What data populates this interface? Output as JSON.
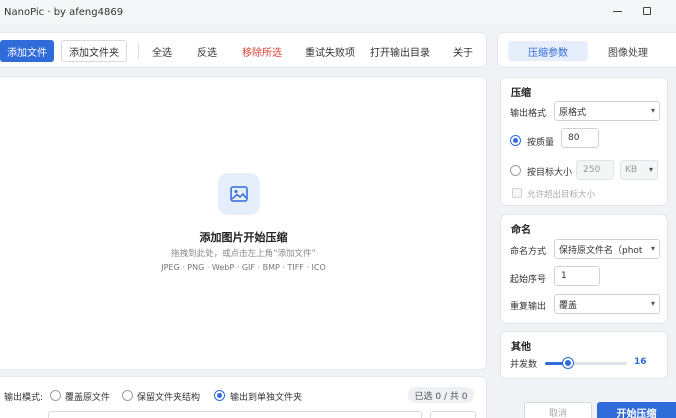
{
  "window": {
    "title": "NanoPic · by afeng4869"
  },
  "toolbar": {
    "add_file": "添加文件",
    "add_folder": "添加文件夹",
    "select_all": "全选",
    "invert": "反选",
    "remove_selected": "移除所选",
    "retry_failed": "重试失败项",
    "open_output": "打开输出目录",
    "about": "关于"
  },
  "dropzone": {
    "title": "添加图片开始压缩",
    "subtitle": "拖拽到此处，或点击左上角“添加文件”",
    "formats": "JPEG · PNG · WebP · GIF · BMP · TIFF · ICO"
  },
  "output": {
    "label": "输出模式:",
    "options": [
      "覆盖原文件",
      "保留文件夹结构",
      "输出到单独文件夹"
    ],
    "selected_index": 2,
    "count": "已选 0 / 共 0"
  },
  "tabs": [
    "压缩参数",
    "图像处理"
  ],
  "compress": {
    "title": "压缩",
    "format_label": "输出格式",
    "format_value": "原格式",
    "quality_label": "按质量",
    "quality_value": "80",
    "target_label": "按目标大小",
    "target_value": "250",
    "target_unit": "KB",
    "allow_exceed": "允许超出目标大小"
  },
  "naming": {
    "title": "命名",
    "mode_label": "命名方式",
    "mode_value": "保持原文件名（phot",
    "start_label": "起始序号",
    "start_value": "1",
    "dup_label": "重复输出",
    "dup_value": "覆盖"
  },
  "other": {
    "title": "其他",
    "concurrency_label": "并发数",
    "concurrency_value": "16",
    "concurrency_fraction": 0.28
  },
  "actions": {
    "cancel": "取消",
    "start": "开始压缩"
  },
  "colors": {
    "accent": "#2f6bd9",
    "danger": "#d9443a"
  }
}
